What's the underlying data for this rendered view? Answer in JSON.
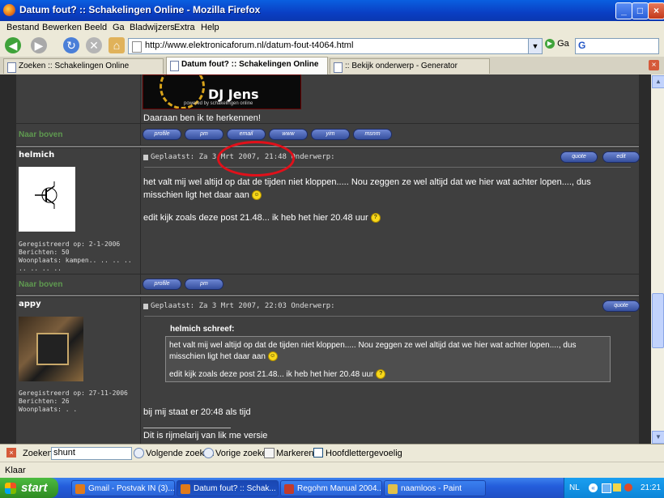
{
  "window": {
    "title": "Datum fout? :: Schakelingen Online - Mozilla Firefox"
  },
  "menu": [
    "Bestand",
    "Bewerken",
    "Beeld",
    "Ga",
    "Bladwijzers",
    "Extra",
    "Help"
  ],
  "nav": {
    "url": "http://www.elektronicaforum.nl/datum-fout-t4064.html",
    "go_label": "Ga",
    "search_letter": "G"
  },
  "tabs": [
    "Zoeken :: Schakelingen Online",
    "Datum fout? :: Schakelingen Online",
    ":: Bekijk onderwerp - Generator"
  ],
  "posts": {
    "top": {
      "banner_title": "DJ Jens",
      "banner_sub": "powered by schakelingen online",
      "text": "Daaraan ben ik te herkennen!",
      "naar_boven": "Naar boven",
      "buttons": [
        "profile",
        "pm",
        "email",
        "www",
        "yim",
        "msnm"
      ]
    },
    "helmich": {
      "author": "helmich",
      "meta": "Geplaatst: Za 3 Mrt 2007, 21:48    Onderwerp:",
      "quote_btn": "quote",
      "edit_btn": "edit",
      "registered": "Geregistreerd op: 2-1-2006",
      "posts": "Berichten: 50",
      "location": "Woonplaats: kampen.. .. .. .. .. .. .. ..",
      "line1": "het valt mij wel altijd op dat de tijden niet kloppen..... Nou zeggen ze wel altijd dat we hier wat achter lopen...., dus misschien ligt het daar aan",
      "line2": "edit kijk zoals deze post 21.48... ik heb het hier 20.48 uur",
      "naar_boven": "Naar boven",
      "buttons": [
        "profile",
        "pm"
      ]
    },
    "appy": {
      "author": "appy",
      "meta": "Geplaatst: Za 3 Mrt 2007, 22:03    Onderwerp:",
      "quote_btn": "quote",
      "registered": "Geregistreerd op: 27-11-2006",
      "posts": "Berichten: 26",
      "location": "Woonplaats: . .",
      "quote_author": "helmich schreef:",
      "quote_line1": "het valt mij wel altijd op dat de tijden niet kloppen..... Nou zeggen ze wel altijd dat we hier wat achter lopen...., dus misschien ligt het daar aan",
      "quote_line2": "edit kijk zoals deze post 21.48... ik heb het hier 20.48 uur",
      "reply": "bij mij staat er 20:48 als tijd",
      "signature": "Dit is rijmelarij van lik me versie"
    }
  },
  "findbar": {
    "label": "Zoeken:",
    "value": "shunt",
    "next": "Volgende zoeken",
    "prev": "Vorige zoeken",
    "highlight": "Markeren",
    "matchcase": "Hoofdlettergevoelig"
  },
  "status": "Klaar",
  "taskbar": {
    "start": "start",
    "items": [
      "Gmail - Postvak IN (3)...",
      "Datum fout? :: Schak...",
      "Regohm Manual 2004...",
      "naamloos - Paint"
    ],
    "lang": "NL",
    "clock": "21:21"
  },
  "colors": {
    "highlight_ring": "#e0101a",
    "naar_boven": "#5f9a50"
  }
}
